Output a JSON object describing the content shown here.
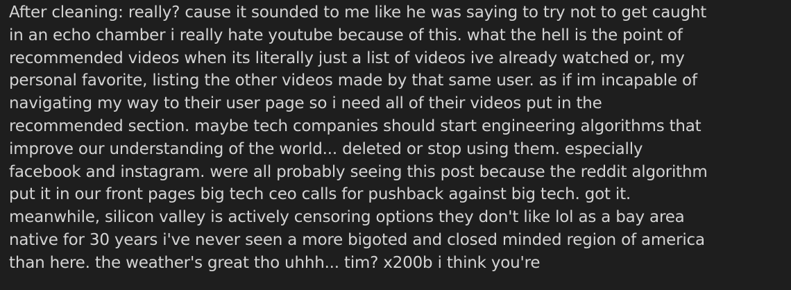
{
  "text_panel": {
    "lines": [
      "After cleaning:  really? cause it sounded to me like he was saying to try not to get caught",
      "in an echo chamber i really hate youtube because of this. what the hell is the point of",
      "recommended videos when its literally just a list of videos ive already watched or, my",
      "personal favorite, listing the other videos made by that same user. as if im incapable of",
      "navigating my way to their user page so i need all of their videos put in the",
      "recommended section. maybe tech companies should start engineering algorithms that",
      "improve our understanding of the world... deleted or stop using them. especially",
      "facebook and instagram. were all probably seeing this post because the reddit algorithm",
      "put it in our front pages big tech ceo calls for pushback against big tech. got it.",
      "meanwhile, silicon valley is actively censoring options they don't like lol as a bay area",
      "native for 30 years i've never seen a more bigoted and closed minded region of america",
      "than here. the weather's great tho uhhh... tim? x200b i think you're"
    ]
  }
}
